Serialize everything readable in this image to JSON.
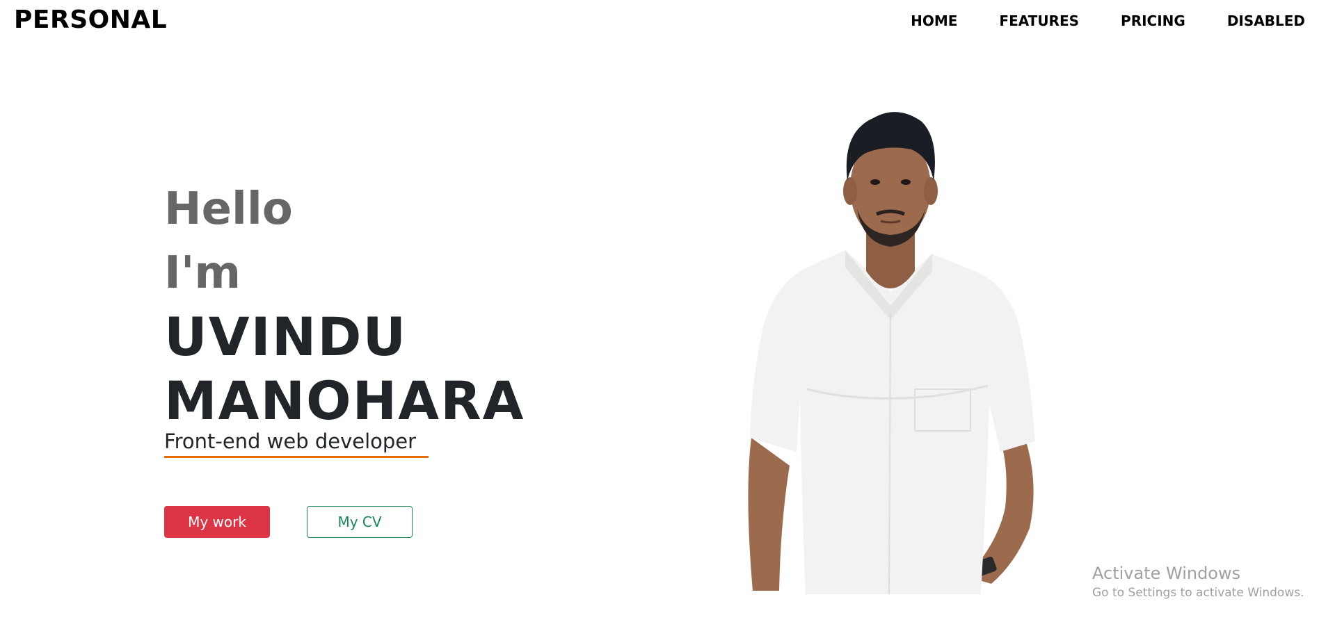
{
  "navbar": {
    "brand": "PERSONAL",
    "links": [
      "HOME",
      "FEATURES",
      "PRICING",
      "DISABLED"
    ]
  },
  "hero": {
    "greeting_line1": "Hello",
    "greeting_line2": "I'm",
    "name_line1": "UVINDU",
    "name_line2": "MANOHARA",
    "role": "Front-end web developer",
    "buttons": {
      "work": "My work",
      "cv": "My CV"
    }
  },
  "watermark": {
    "title": "Activate Windows",
    "subtitle": "Go to Settings to activate Windows."
  },
  "colors": {
    "greeting": "#666666",
    "name": "#212529",
    "role_underline": "#e36c0a",
    "work_button": "#dc3545",
    "cv_button": "#198754"
  }
}
